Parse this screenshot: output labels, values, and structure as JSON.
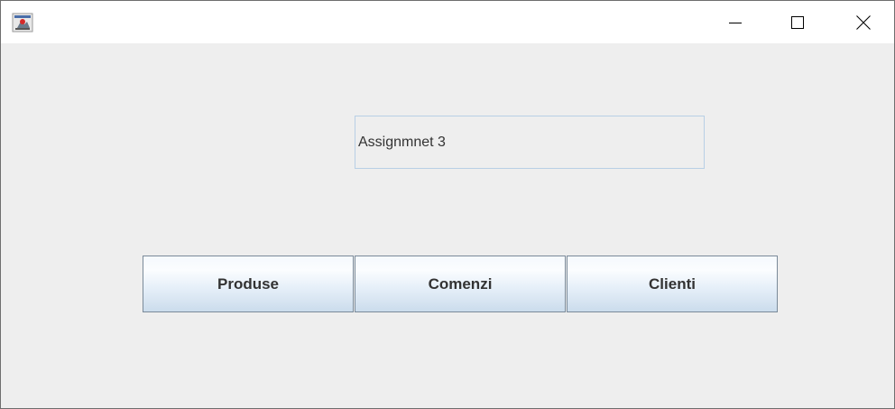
{
  "window": {
    "icon": "java-app-icon",
    "controls": {
      "minimize_icon": "minimize-icon",
      "maximize_icon": "maximize-icon",
      "close_icon": "close-icon"
    }
  },
  "main": {
    "title_field_value": "Assignmnet 3",
    "buttons": [
      {
        "label": "Produse"
      },
      {
        "label": "Comenzi"
      },
      {
        "label": "Clienti"
      }
    ]
  },
  "colors": {
    "background": "#eeeeee",
    "titlebar": "#ffffff",
    "field_border": "#b8cfe5",
    "button_border": "#7a8a99",
    "text": "#333333"
  }
}
